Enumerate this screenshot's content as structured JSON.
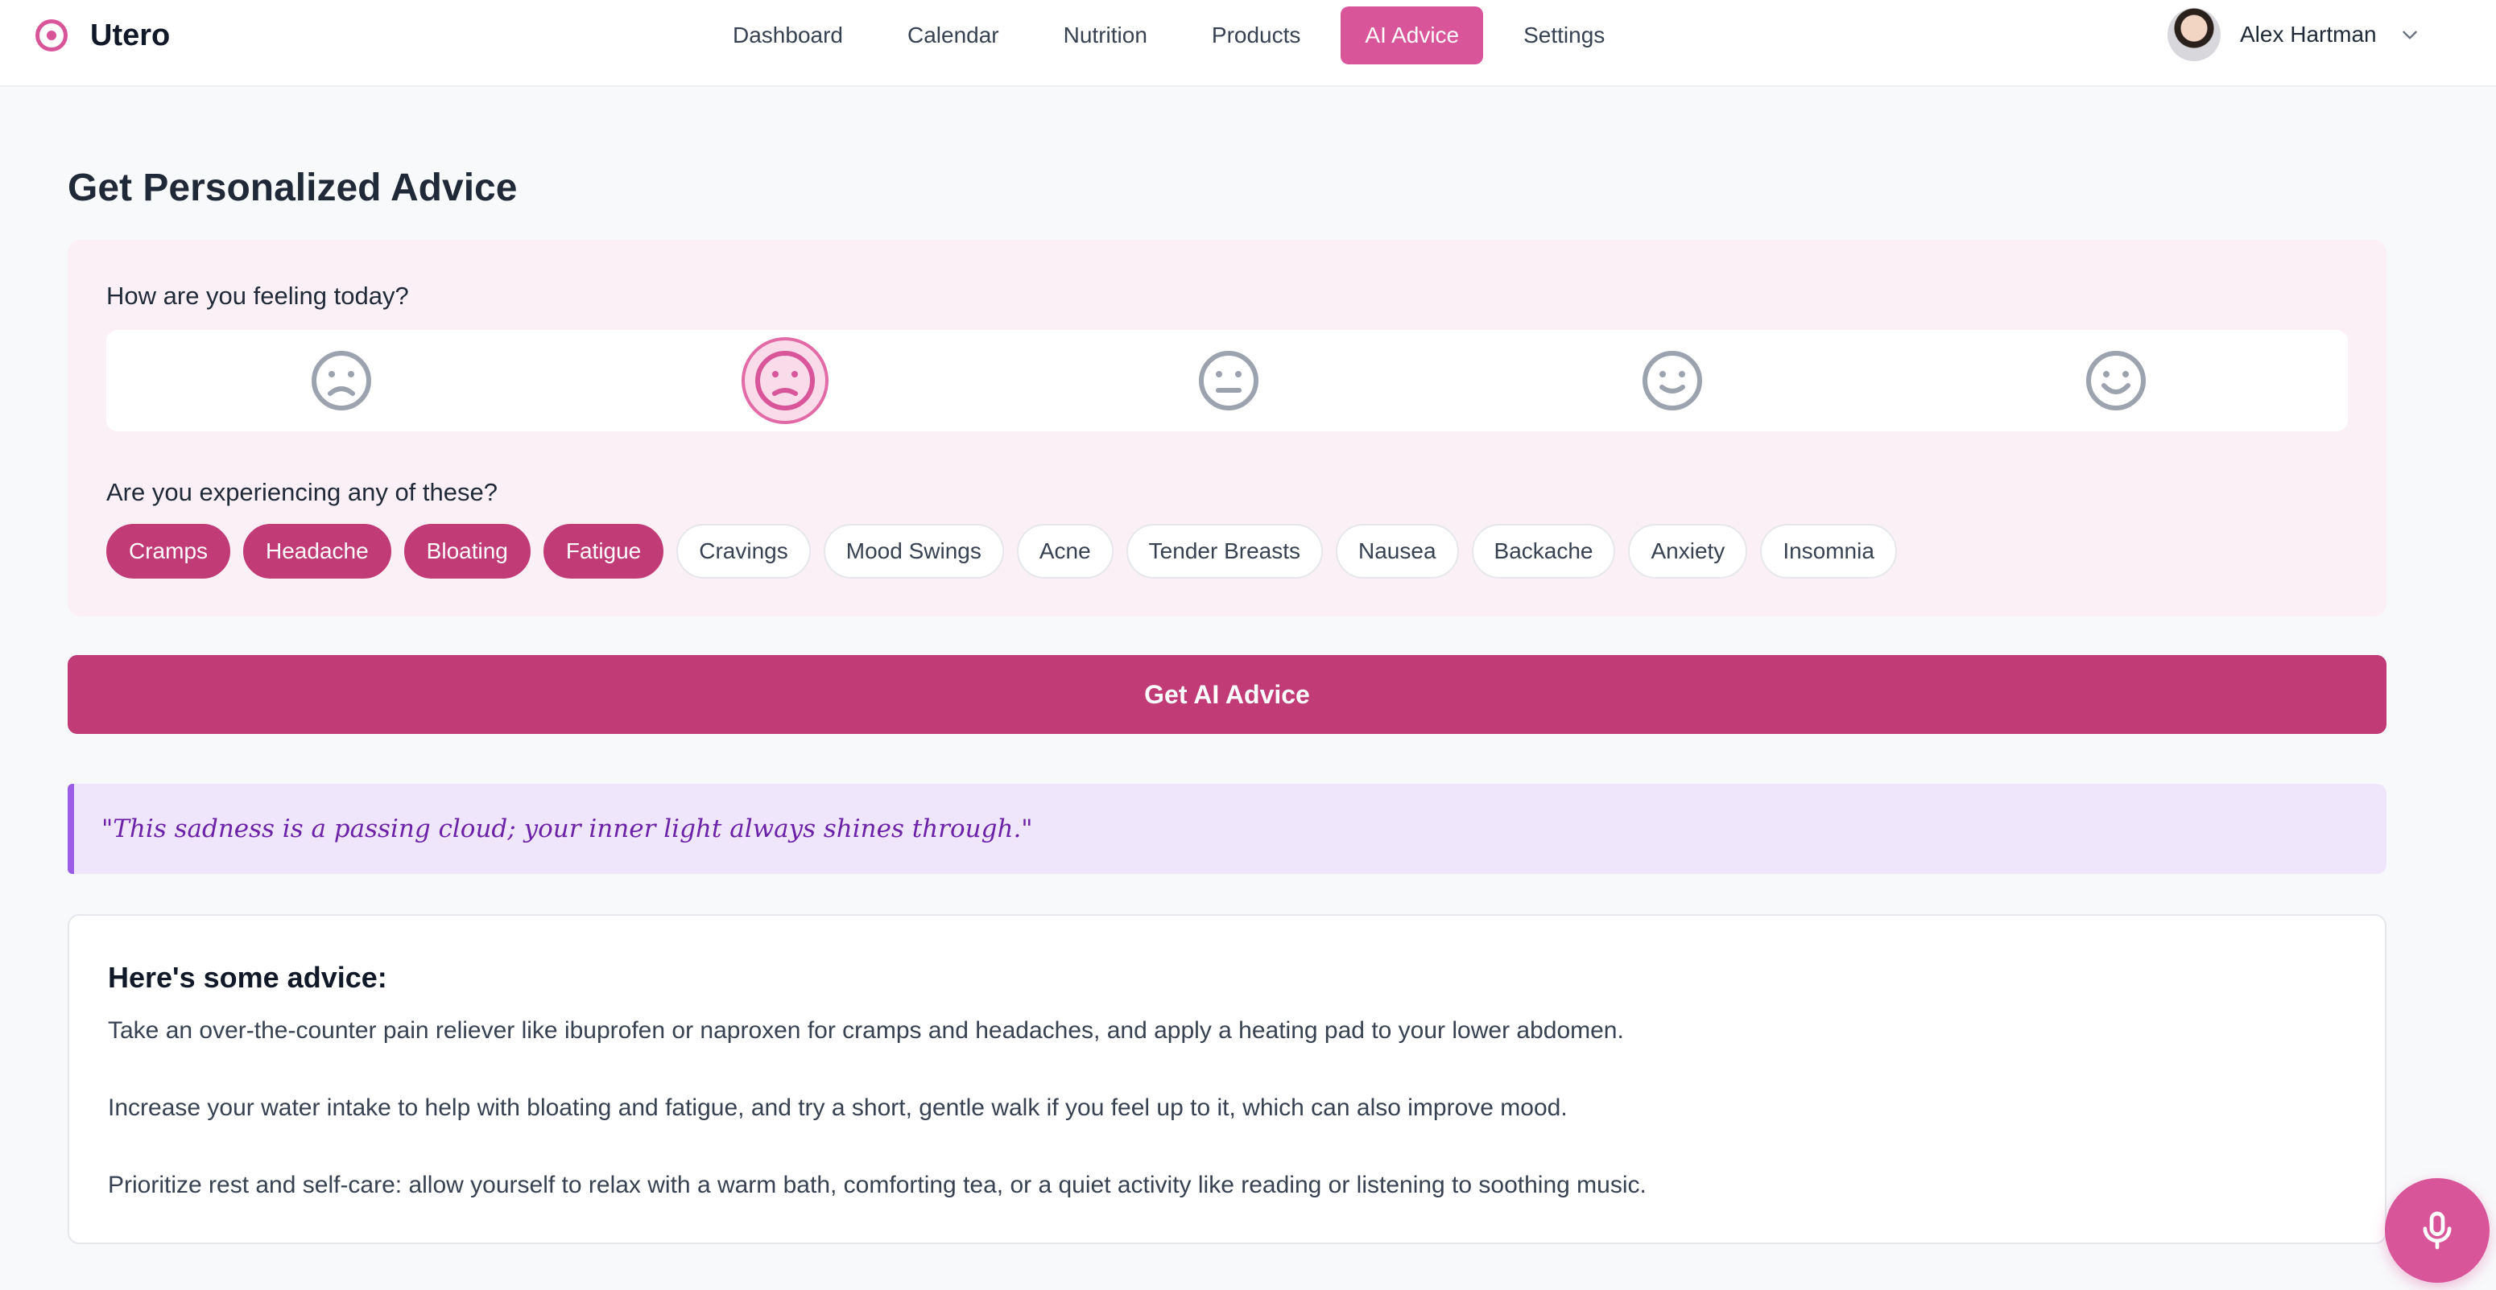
{
  "app": {
    "name": "Utero"
  },
  "nav": {
    "items": [
      {
        "label": "Dashboard"
      },
      {
        "label": "Calendar"
      },
      {
        "label": "Nutrition"
      },
      {
        "label": "Products"
      },
      {
        "label": "AI Advice",
        "active": true
      },
      {
        "label": "Settings"
      }
    ]
  },
  "user": {
    "name": "Alex Hartman"
  },
  "page": {
    "title": "Get Personalized Advice"
  },
  "mood": {
    "question": "How are you feeling today?",
    "options": [
      {
        "icon": "very-sad-face-icon"
      },
      {
        "icon": "sad-face-icon",
        "selected": true
      },
      {
        "icon": "neutral-face-icon"
      },
      {
        "icon": "happy-face-icon"
      },
      {
        "icon": "very-happy-face-icon"
      }
    ]
  },
  "symptoms": {
    "question": "Are you experiencing any of these?",
    "items": [
      {
        "label": "Cramps",
        "selected": true
      },
      {
        "label": "Headache",
        "selected": true
      },
      {
        "label": "Bloating",
        "selected": true
      },
      {
        "label": "Fatigue",
        "selected": true
      },
      {
        "label": "Cravings",
        "selected": false
      },
      {
        "label": "Mood Swings",
        "selected": false
      },
      {
        "label": "Acne",
        "selected": false
      },
      {
        "label": "Tender Breasts",
        "selected": false
      },
      {
        "label": "Nausea",
        "selected": false
      },
      {
        "label": "Backache",
        "selected": false
      },
      {
        "label": "Anxiety",
        "selected": false
      },
      {
        "label": "Insomnia",
        "selected": false
      }
    ]
  },
  "cta": {
    "label": "Get AI Advice"
  },
  "quote": {
    "text": "\"This sadness is a passing cloud; your inner light always shines through.\""
  },
  "advice": {
    "title": "Here's some advice:",
    "paragraphs": [
      "Take an over-the-counter pain reliever like ibuprofen or naproxen for cramps and headaches, and apply a heating pad to your lower abdomen.",
      "Increase your water intake to help with bloating and fatigue, and try a short, gentle walk if you feel up to it, which can also improve mood.",
      "Prioritize rest and self-care: allow yourself to relax with a warm bath, comforting tea, or a quiet activity like reading or listening to soothing music."
    ]
  },
  "icons": {
    "mic": "microphone-icon",
    "chevron": "chevron-down-icon",
    "logo": "target-logo-icon"
  },
  "colors": {
    "accent": "#d9559a",
    "accent_dark": "#c13b76",
    "quote_bg": "#efe6fb",
    "quote_text": "#6b21a8"
  }
}
